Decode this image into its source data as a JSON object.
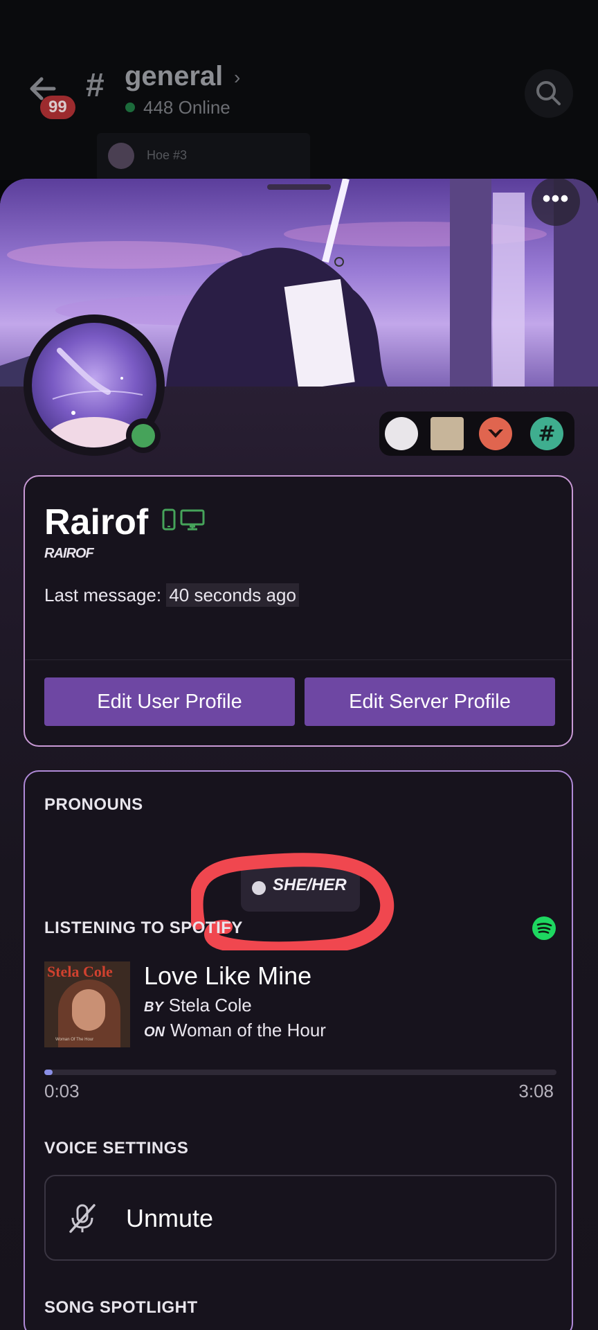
{
  "header": {
    "unread_count": "99",
    "channel_name": "general",
    "online_count": "448 Online",
    "thread_label": "Hoe #3"
  },
  "profile": {
    "display_name": "Rairof",
    "nickname": "RAIROF",
    "last_message_label": "Last message:",
    "last_message_value": "40 seconds ago",
    "status": "online"
  },
  "actions": {
    "edit_user_profile": "Edit User Profile",
    "edit_server_profile": "Edit Server Profile"
  },
  "pronouns": {
    "title": "PRONOUNS",
    "value": "SHE/HER"
  },
  "spotify": {
    "title": "LISTENING TO SPOTIFY",
    "song": "Love Like Mine",
    "by_label": "BY",
    "artist": "Stela Cole",
    "on_label": "ON",
    "album": "Woman of the Hour",
    "album_art_title": "Stela Cole",
    "album_art_subtitle": "Woman Of The Hour",
    "elapsed": "0:03",
    "duration": "3:08",
    "progress_fraction": 0.016
  },
  "voice": {
    "title": "VOICE SETTINGS",
    "unmute_label": "Unmute"
  },
  "song_spotlight": {
    "title": "SONG SPOTLIGHT"
  },
  "colors": {
    "accent": "#6e47a3",
    "online": "#46a35a",
    "spotify": "#1ed760",
    "annotation": "#f0474f"
  }
}
